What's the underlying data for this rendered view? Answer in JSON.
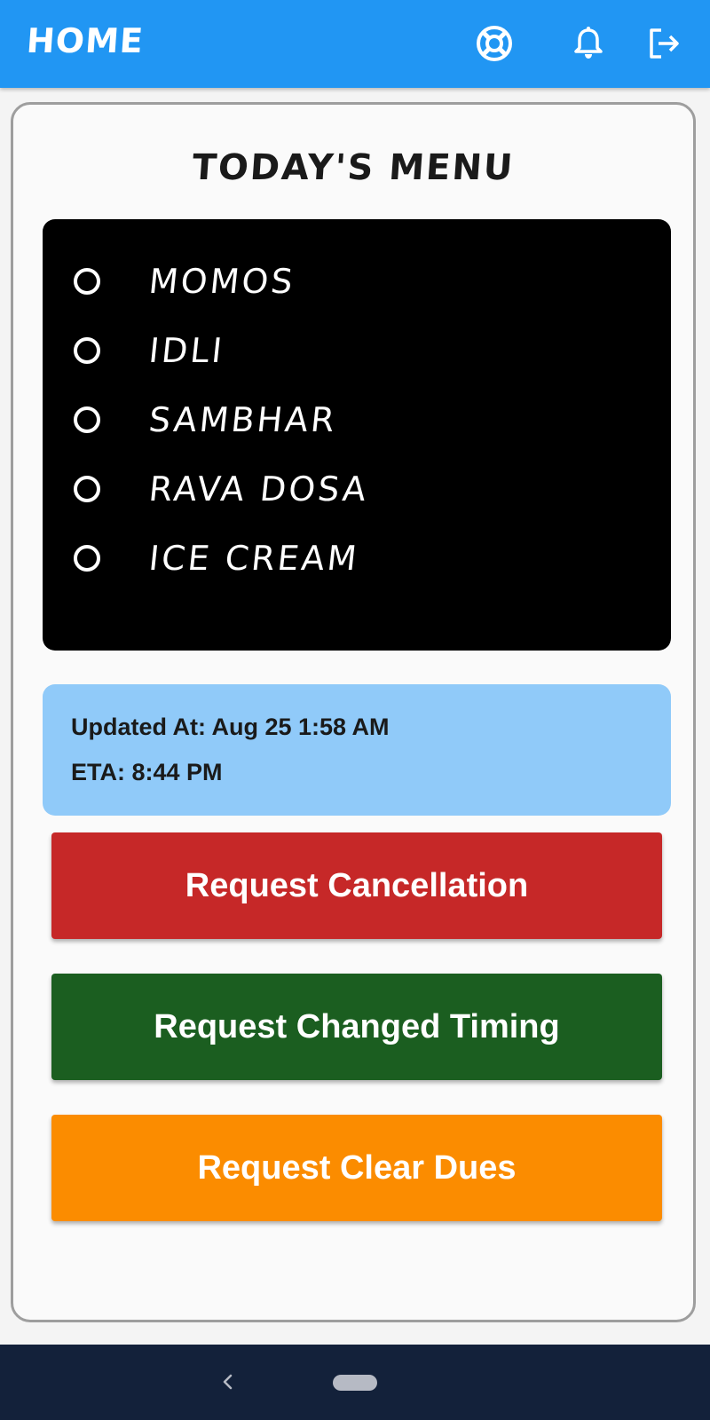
{
  "app_bar": {
    "title": "HOME",
    "icons": [
      "lifebuoy-icon",
      "bell-icon",
      "logout-icon"
    ],
    "color": "#2196f3"
  },
  "menu": {
    "title": "TODAY'S MENU",
    "items": [
      {
        "label": "MOMOS"
      },
      {
        "label": "IDLI"
      },
      {
        "label": "SAMBHAR"
      },
      {
        "label": "RAVA DOSA"
      },
      {
        "label": "ICE CREAM"
      }
    ]
  },
  "info": {
    "updated_at": "Updated At: Aug 25 1:58 AM",
    "eta": "ETA: 8:44 PM",
    "color": "#90caf9"
  },
  "actions": {
    "cancellation": {
      "label": "Request Cancellation",
      "color": "#c62828"
    },
    "changed_timing": {
      "label": "Request Changed Timing",
      "color": "#1b5e20"
    },
    "clear_dues": {
      "label": "Request Clear Dues",
      "color": "#fb8c00"
    }
  },
  "nav_bar": {
    "icons": [
      "back-icon",
      "home-pill-icon"
    ]
  }
}
